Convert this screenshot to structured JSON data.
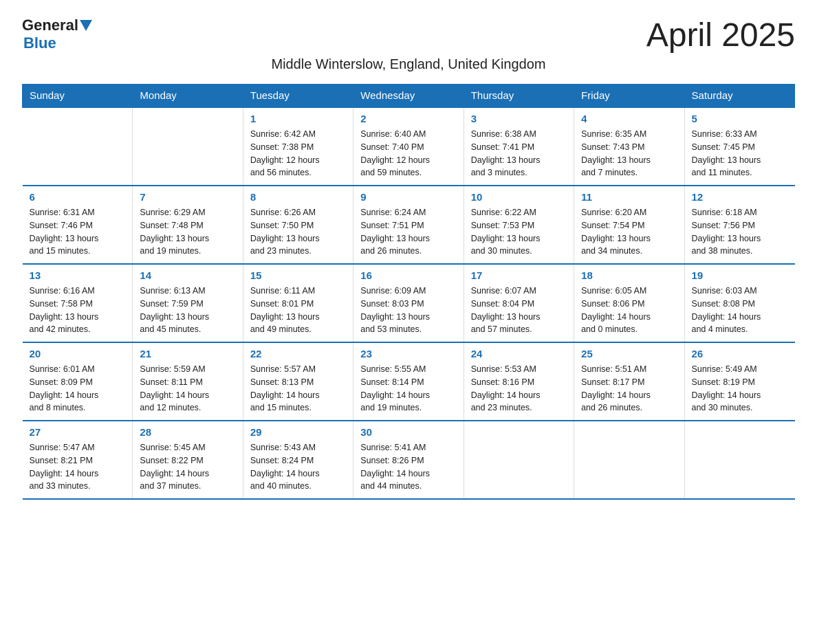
{
  "logo": {
    "general": "General",
    "arrow": "▶",
    "blue": "Blue"
  },
  "title": "April 2025",
  "subtitle": "Middle Winterslow, England, United Kingdom",
  "weekdays": [
    "Sunday",
    "Monday",
    "Tuesday",
    "Wednesday",
    "Thursday",
    "Friday",
    "Saturday"
  ],
  "weeks": [
    [
      {
        "day": "",
        "info": ""
      },
      {
        "day": "",
        "info": ""
      },
      {
        "day": "1",
        "info": "Sunrise: 6:42 AM\nSunset: 7:38 PM\nDaylight: 12 hours\nand 56 minutes."
      },
      {
        "day": "2",
        "info": "Sunrise: 6:40 AM\nSunset: 7:40 PM\nDaylight: 12 hours\nand 59 minutes."
      },
      {
        "day": "3",
        "info": "Sunrise: 6:38 AM\nSunset: 7:41 PM\nDaylight: 13 hours\nand 3 minutes."
      },
      {
        "day": "4",
        "info": "Sunrise: 6:35 AM\nSunset: 7:43 PM\nDaylight: 13 hours\nand 7 minutes."
      },
      {
        "day": "5",
        "info": "Sunrise: 6:33 AM\nSunset: 7:45 PM\nDaylight: 13 hours\nand 11 minutes."
      }
    ],
    [
      {
        "day": "6",
        "info": "Sunrise: 6:31 AM\nSunset: 7:46 PM\nDaylight: 13 hours\nand 15 minutes."
      },
      {
        "day": "7",
        "info": "Sunrise: 6:29 AM\nSunset: 7:48 PM\nDaylight: 13 hours\nand 19 minutes."
      },
      {
        "day": "8",
        "info": "Sunrise: 6:26 AM\nSunset: 7:50 PM\nDaylight: 13 hours\nand 23 minutes."
      },
      {
        "day": "9",
        "info": "Sunrise: 6:24 AM\nSunset: 7:51 PM\nDaylight: 13 hours\nand 26 minutes."
      },
      {
        "day": "10",
        "info": "Sunrise: 6:22 AM\nSunset: 7:53 PM\nDaylight: 13 hours\nand 30 minutes."
      },
      {
        "day": "11",
        "info": "Sunrise: 6:20 AM\nSunset: 7:54 PM\nDaylight: 13 hours\nand 34 minutes."
      },
      {
        "day": "12",
        "info": "Sunrise: 6:18 AM\nSunset: 7:56 PM\nDaylight: 13 hours\nand 38 minutes."
      }
    ],
    [
      {
        "day": "13",
        "info": "Sunrise: 6:16 AM\nSunset: 7:58 PM\nDaylight: 13 hours\nand 42 minutes."
      },
      {
        "day": "14",
        "info": "Sunrise: 6:13 AM\nSunset: 7:59 PM\nDaylight: 13 hours\nand 45 minutes."
      },
      {
        "day": "15",
        "info": "Sunrise: 6:11 AM\nSunset: 8:01 PM\nDaylight: 13 hours\nand 49 minutes."
      },
      {
        "day": "16",
        "info": "Sunrise: 6:09 AM\nSunset: 8:03 PM\nDaylight: 13 hours\nand 53 minutes."
      },
      {
        "day": "17",
        "info": "Sunrise: 6:07 AM\nSunset: 8:04 PM\nDaylight: 13 hours\nand 57 minutes."
      },
      {
        "day": "18",
        "info": "Sunrise: 6:05 AM\nSunset: 8:06 PM\nDaylight: 14 hours\nand 0 minutes."
      },
      {
        "day": "19",
        "info": "Sunrise: 6:03 AM\nSunset: 8:08 PM\nDaylight: 14 hours\nand 4 minutes."
      }
    ],
    [
      {
        "day": "20",
        "info": "Sunrise: 6:01 AM\nSunset: 8:09 PM\nDaylight: 14 hours\nand 8 minutes."
      },
      {
        "day": "21",
        "info": "Sunrise: 5:59 AM\nSunset: 8:11 PM\nDaylight: 14 hours\nand 12 minutes."
      },
      {
        "day": "22",
        "info": "Sunrise: 5:57 AM\nSunset: 8:13 PM\nDaylight: 14 hours\nand 15 minutes."
      },
      {
        "day": "23",
        "info": "Sunrise: 5:55 AM\nSunset: 8:14 PM\nDaylight: 14 hours\nand 19 minutes."
      },
      {
        "day": "24",
        "info": "Sunrise: 5:53 AM\nSunset: 8:16 PM\nDaylight: 14 hours\nand 23 minutes."
      },
      {
        "day": "25",
        "info": "Sunrise: 5:51 AM\nSunset: 8:17 PM\nDaylight: 14 hours\nand 26 minutes."
      },
      {
        "day": "26",
        "info": "Sunrise: 5:49 AM\nSunset: 8:19 PM\nDaylight: 14 hours\nand 30 minutes."
      }
    ],
    [
      {
        "day": "27",
        "info": "Sunrise: 5:47 AM\nSunset: 8:21 PM\nDaylight: 14 hours\nand 33 minutes."
      },
      {
        "day": "28",
        "info": "Sunrise: 5:45 AM\nSunset: 8:22 PM\nDaylight: 14 hours\nand 37 minutes."
      },
      {
        "day": "29",
        "info": "Sunrise: 5:43 AM\nSunset: 8:24 PM\nDaylight: 14 hours\nand 40 minutes."
      },
      {
        "day": "30",
        "info": "Sunrise: 5:41 AM\nSunset: 8:26 PM\nDaylight: 14 hours\nand 44 minutes."
      },
      {
        "day": "",
        "info": ""
      },
      {
        "day": "",
        "info": ""
      },
      {
        "day": "",
        "info": ""
      }
    ]
  ]
}
